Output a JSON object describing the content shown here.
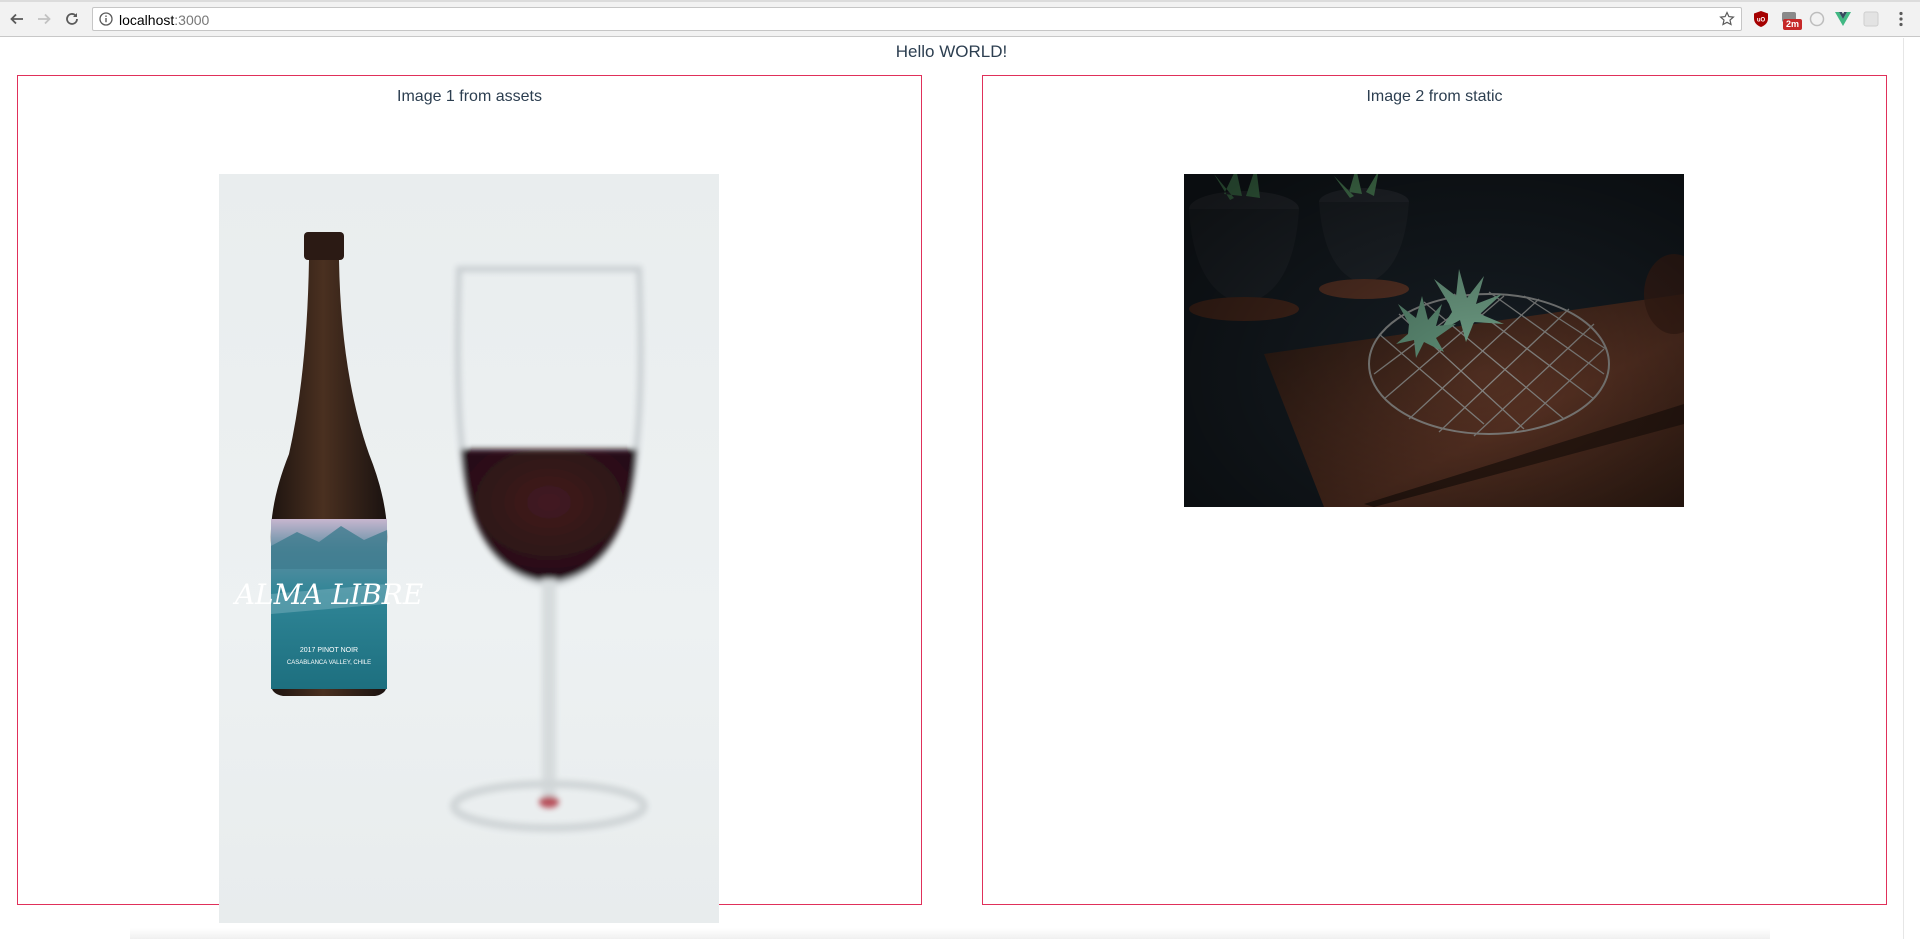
{
  "browser": {
    "url_host": "localhost",
    "url_port": ":3000",
    "badge": "2m",
    "icons": {
      "back": "back-arrow-icon",
      "forward": "forward-arrow-icon",
      "reload": "reload-icon",
      "info": "info-icon",
      "bookmark": "star-icon",
      "menu": "kebab-menu-icon"
    }
  },
  "page": {
    "heading": "Hello WORLD!",
    "panels": [
      {
        "title": "Image 1 from assets",
        "image": "wine-bottle-and-glass"
      },
      {
        "title": "Image 2 from static",
        "image": "succulents-on-wire-basket"
      }
    ],
    "label_art": {
      "brand": "ALMA LIBRE",
      "line1": "2017 PINOT NOIR",
      "line2": "CASABLANCA VALLEY, CHILE"
    }
  },
  "colors": {
    "panel_border": "#e0305a",
    "text": "#2c3e50",
    "badge": "#c62828"
  }
}
